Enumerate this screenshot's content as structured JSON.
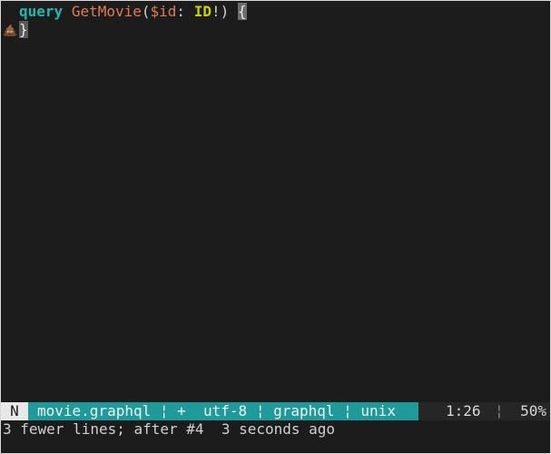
{
  "editor": {
    "line1": {
      "keyword": "query",
      "function": "GetMovie",
      "open_paren": "(",
      "variable": "$id",
      "colon": ": ",
      "type": "ID",
      "bang": "!",
      "close_paren": ") ",
      "open_brace": "{"
    },
    "line2": {
      "sign_icon": "pile-of-poo-icon",
      "close_brace": "}"
    }
  },
  "statusline": {
    "mode": "N",
    "segment": "movie.graphql ¦ +  utf-8 ¦ graphql ¦ unix",
    "position": "1:26",
    "separator": "¦",
    "percent": "50%"
  },
  "message": "3 fewer lines; after #4  3 seconds ago",
  "colors": {
    "background": "#1c1c1c",
    "keyword": "#1fb8b0",
    "function": "#e07b53",
    "type": "#c8d400",
    "status_accent": "#1f9a9a"
  }
}
